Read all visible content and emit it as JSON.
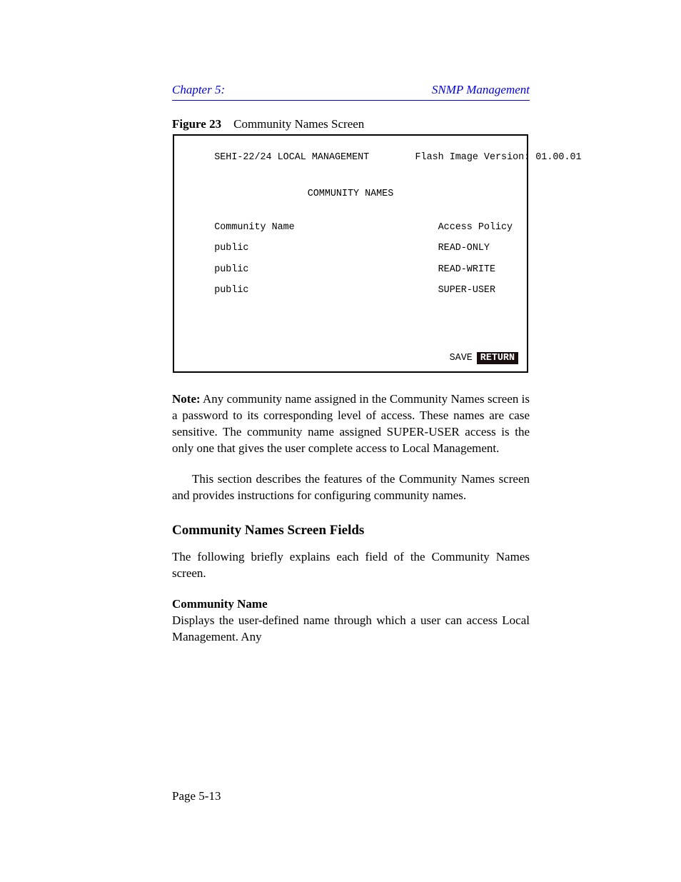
{
  "header": {
    "left": "Chapter 5:",
    "right": "SNMP Management"
  },
  "figure": {
    "label": "Figure 23",
    "caption": "Community Names Screen"
  },
  "panel": {
    "title": "COMMUNITY NAMES",
    "model": "SEHI-22/24",
    "lm_type": "LOCAL MANAGEMENT",
    "fw_ver_label": "Flash Image Version:",
    "fw_ver_value": "01.00.01",
    "col1": "Community Name",
    "col2": "Access Policy",
    "rows": [
      {
        "name": "public",
        "policy": "READ-ONLY"
      },
      {
        "name": "public",
        "policy": "READ-WRITE"
      },
      {
        "name": "public",
        "policy": "SUPER-USER"
      }
    ],
    "save": "SAVE",
    "return": "RETURN"
  },
  "body": {
    "note_label": "Note:",
    "note_text": "Any community name assigned in the Community Names screen is a password to its corresponding level of access. These names are case sensitive. The community name assigned SUPER-USER access is the only one that gives the user complete access to Local Management.",
    "para1": "This section describes the features of the Community Names screen and provides instructions for configuring community names.",
    "h2": "Community Names Screen Fields",
    "para2": "The following briefly explains each field of the Community Names screen.",
    "cn_heading": "Community Name",
    "cn_text": "Displays the user-defined name through which a user can access Local Management. Any"
  },
  "footer": {
    "left": "Page 5-13",
    "right": ""
  }
}
